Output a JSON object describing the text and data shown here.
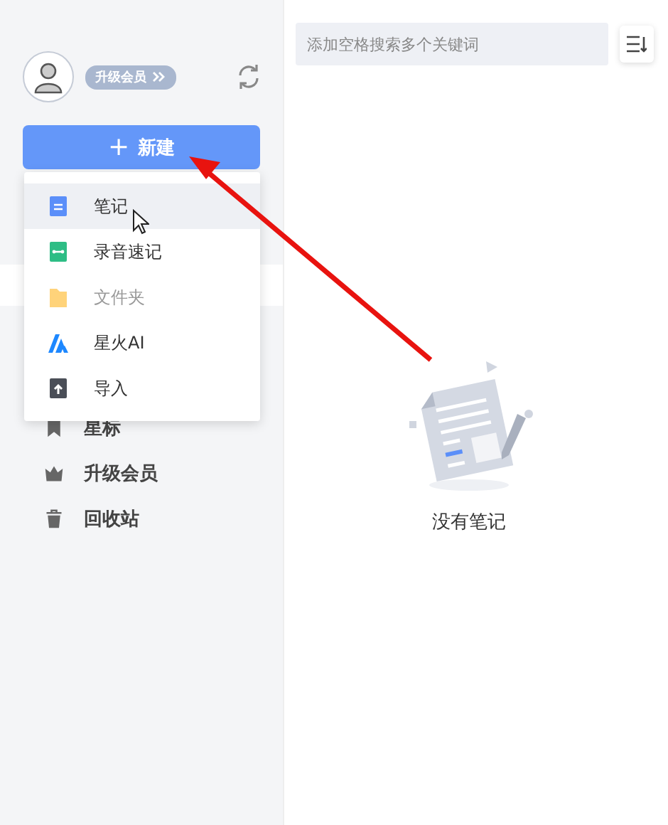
{
  "profile": {
    "badge": "升级会员"
  },
  "new_button": {
    "label": "新建",
    "icon": "+"
  },
  "new_menu": [
    {
      "kind": "note",
      "label": "笔记",
      "selected": true,
      "disabled": false
    },
    {
      "kind": "audio",
      "label": "录音速记",
      "selected": false,
      "disabled": false
    },
    {
      "kind": "folder",
      "label": "文件夹",
      "selected": false,
      "disabled": true
    },
    {
      "kind": "ai",
      "label": "星火AI",
      "selected": false,
      "disabled": false
    },
    {
      "kind": "import",
      "label": "导入",
      "selected": false,
      "disabled": false
    }
  ],
  "sidebar": {
    "items": [
      {
        "kind": "star",
        "label": "星标"
      },
      {
        "kind": "crown",
        "label": "升级会员"
      },
      {
        "kind": "trash",
        "label": "回收站"
      }
    ]
  },
  "search": {
    "placeholder": "添加空格搜索多个关键词"
  },
  "empty_state": {
    "message": "没有笔记"
  }
}
